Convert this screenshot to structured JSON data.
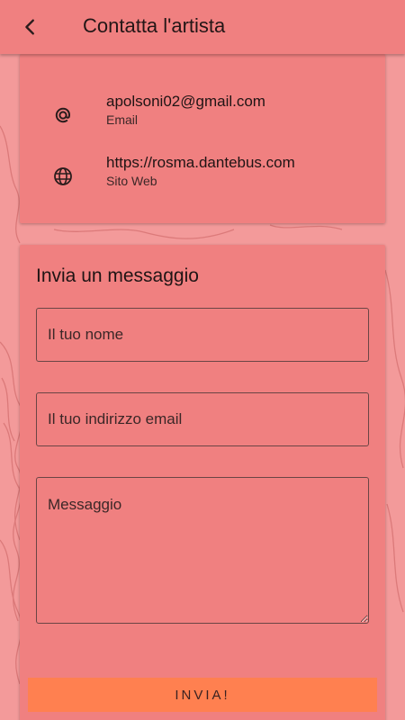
{
  "app_bar": {
    "title": "Contatta l'artista",
    "back_icon": "chevron-left-icon"
  },
  "contact_info": {
    "email": {
      "value": "apolsoni02@gmail.com",
      "label": "Email",
      "icon": "at-sign-icon"
    },
    "website": {
      "value": "https://rosma.dantebus.com",
      "label": "Sito Web",
      "icon": "globe-icon"
    }
  },
  "message_form": {
    "title": "Invia un messaggio",
    "name_placeholder": "Il tuo nome",
    "email_placeholder": "Il tuo indirizzo email",
    "message_placeholder": "Messaggio",
    "submit_label": "INVIA!"
  },
  "colors": {
    "card": "#f08080",
    "background": "#f39a9a",
    "submit_button": "#ff8050"
  }
}
